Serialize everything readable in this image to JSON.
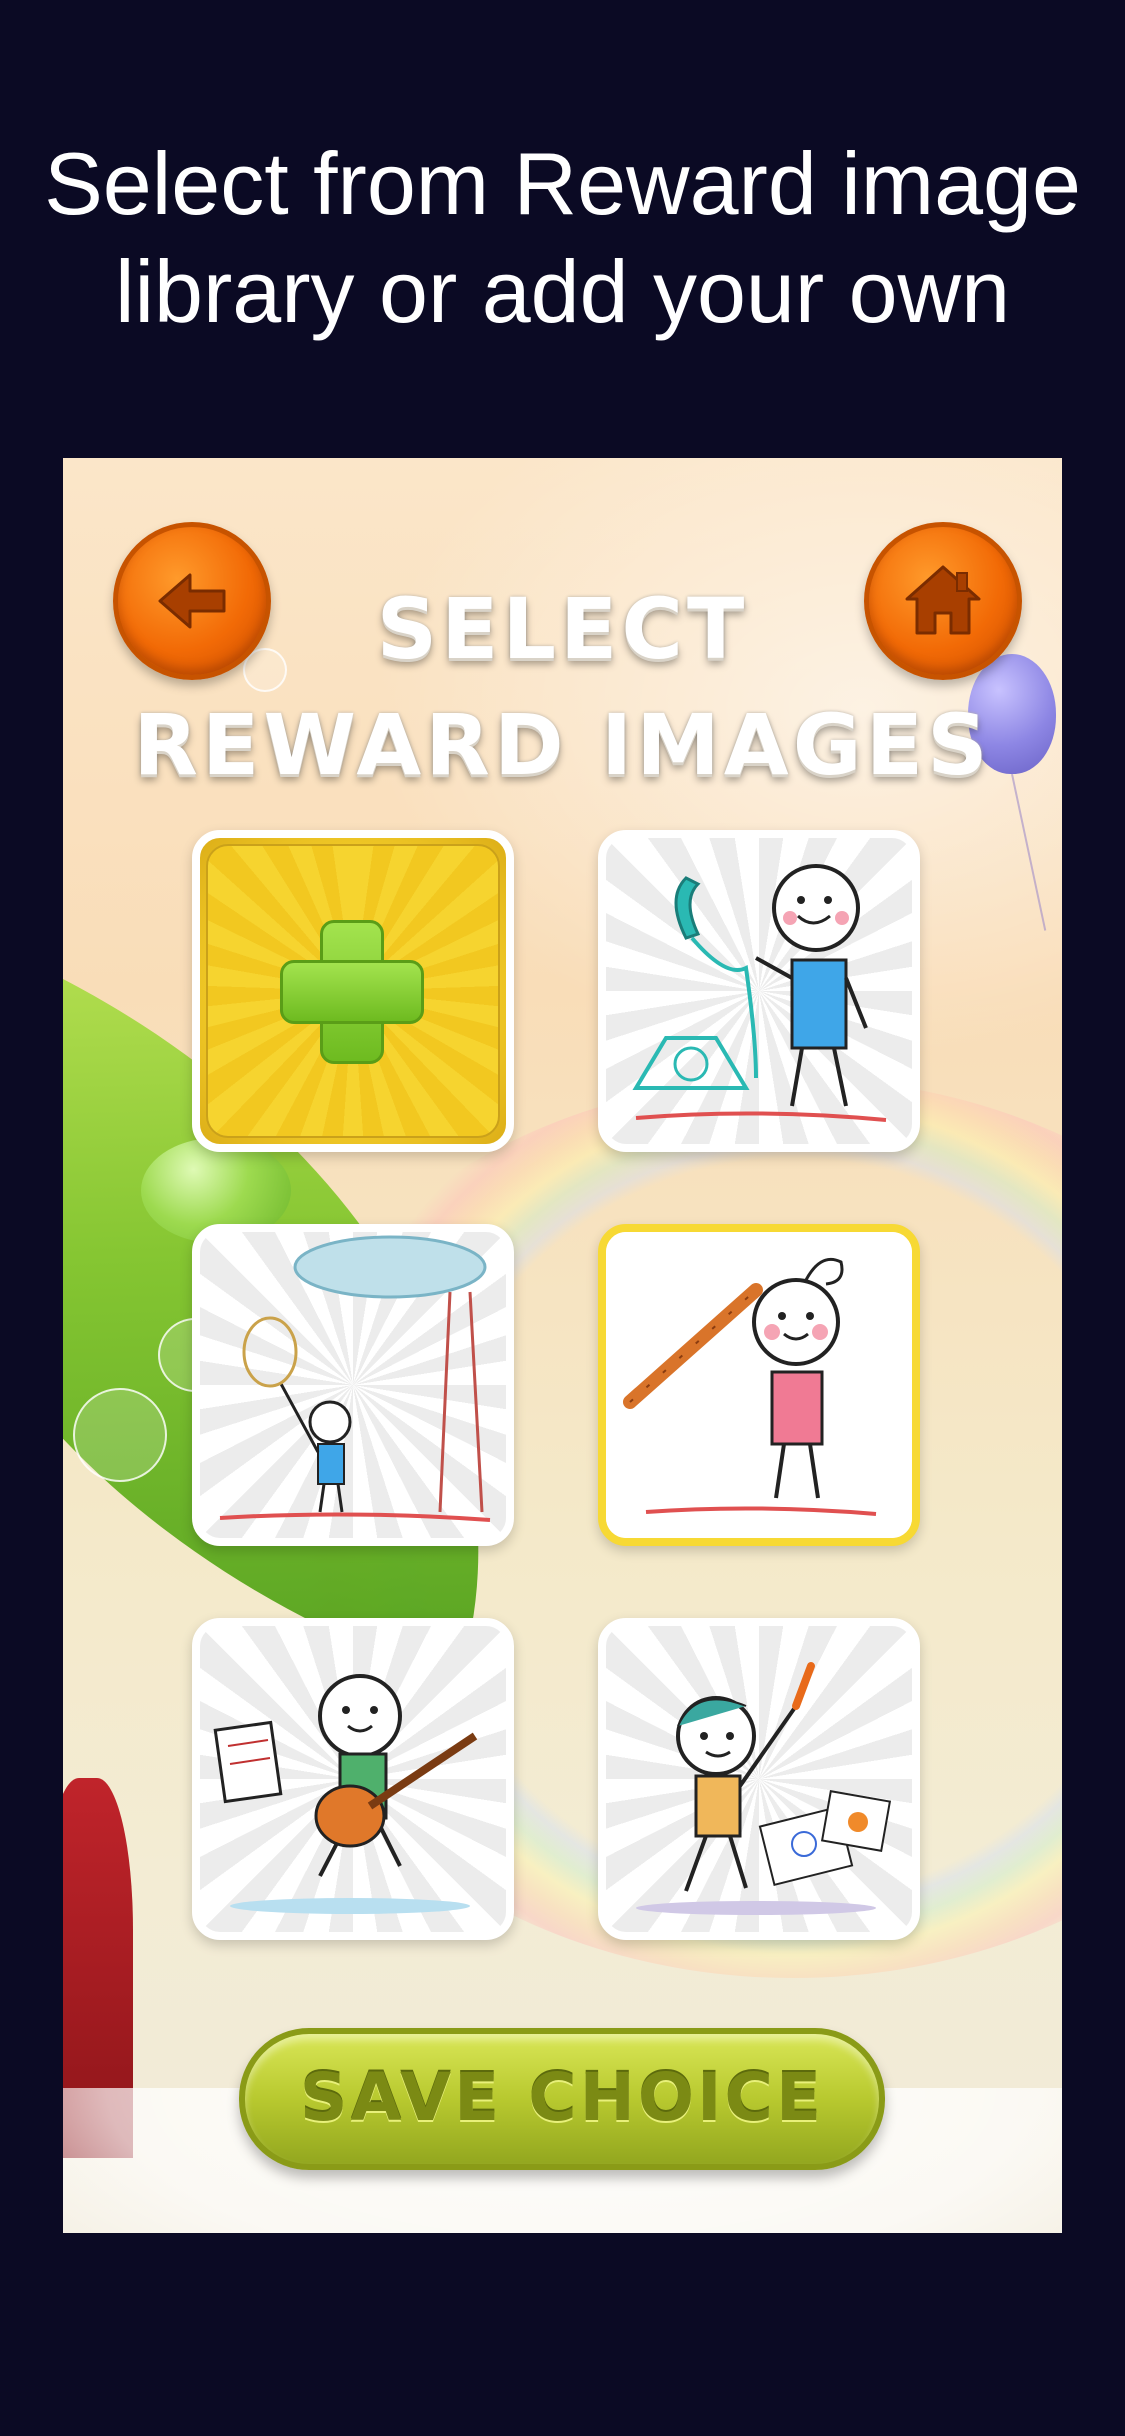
{
  "caption": {
    "line1": "Select from Reward image",
    "line2": "library or add your own"
  },
  "header": {
    "title_line1": "SELECT",
    "title_line2": "REWARD IMAGES",
    "back_icon": "arrow-left-icon",
    "home_icon": "home-icon"
  },
  "tiles": [
    {
      "name": "add-image",
      "icon": "plus-icon",
      "selected": false
    },
    {
      "name": "telephone-reward",
      "selected": false
    },
    {
      "name": "butterfly-net-reward",
      "selected": false
    },
    {
      "name": "flute-reward",
      "selected": true
    },
    {
      "name": "guitar-reward",
      "selected": false
    },
    {
      "name": "painting-reward",
      "selected": false
    }
  ],
  "save_button": {
    "label": "SAVE CHOICE"
  },
  "colors": {
    "background": "#0b0a24",
    "orange_button": "#f26a06",
    "save_button": "#b8c92f",
    "selected_border": "#f7d934"
  }
}
